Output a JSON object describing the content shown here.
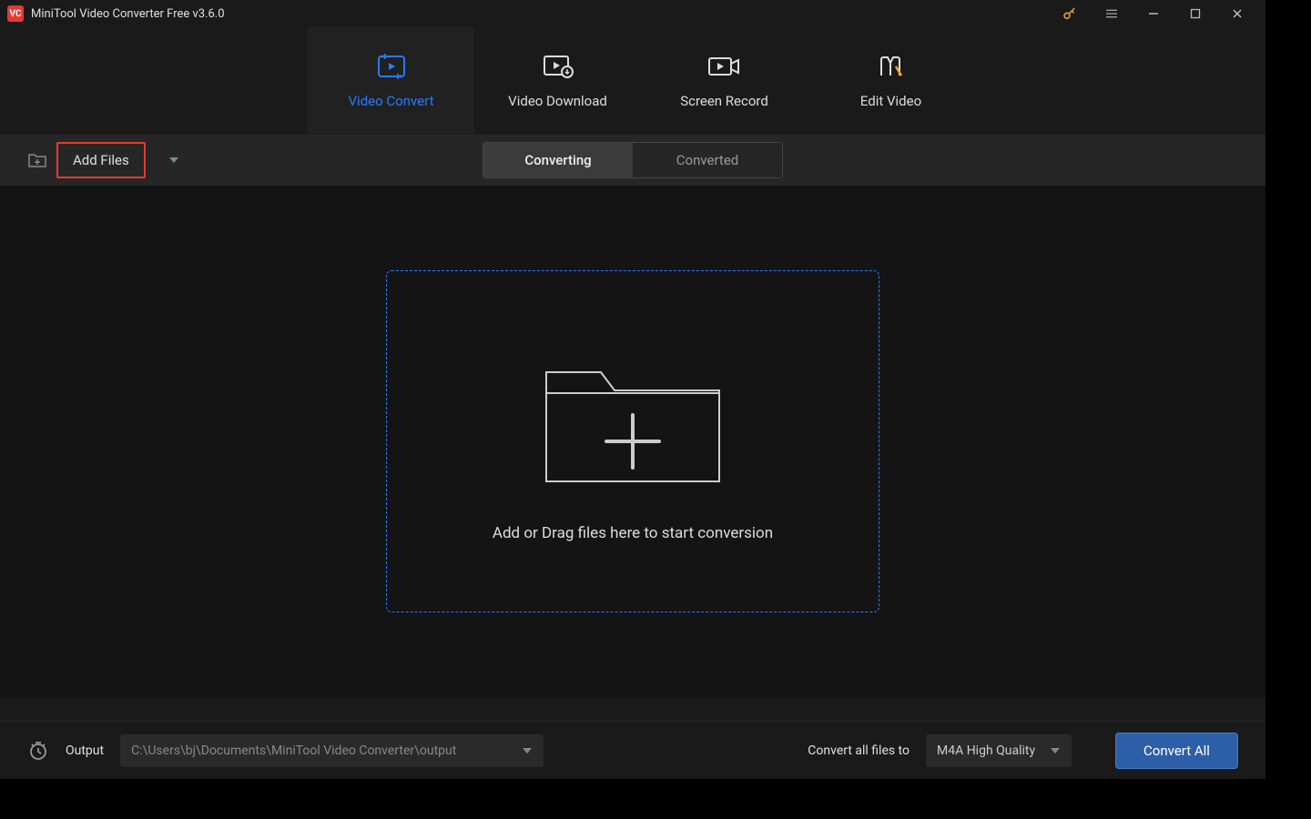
{
  "titlebar": {
    "app_title": "MiniTool Video Converter Free v3.6.0"
  },
  "main_tabs": {
    "video_convert": "Video Convert",
    "video_download": "Video Download",
    "screen_record": "Screen Record",
    "edit_video": "Edit Video"
  },
  "toolbar": {
    "add_files": "Add Files"
  },
  "sub_tabs": {
    "converting": "Converting",
    "converted": "Converted"
  },
  "dropzone": {
    "text": "Add or Drag files here to start conversion"
  },
  "footer": {
    "output_label": "Output",
    "output_path": "C:\\Users\\bj\\Documents\\MiniTool Video Converter\\output",
    "convert_all_label": "Convert all files to",
    "convert_target": "M4A High Quality",
    "convert_all_btn": "Convert All"
  }
}
